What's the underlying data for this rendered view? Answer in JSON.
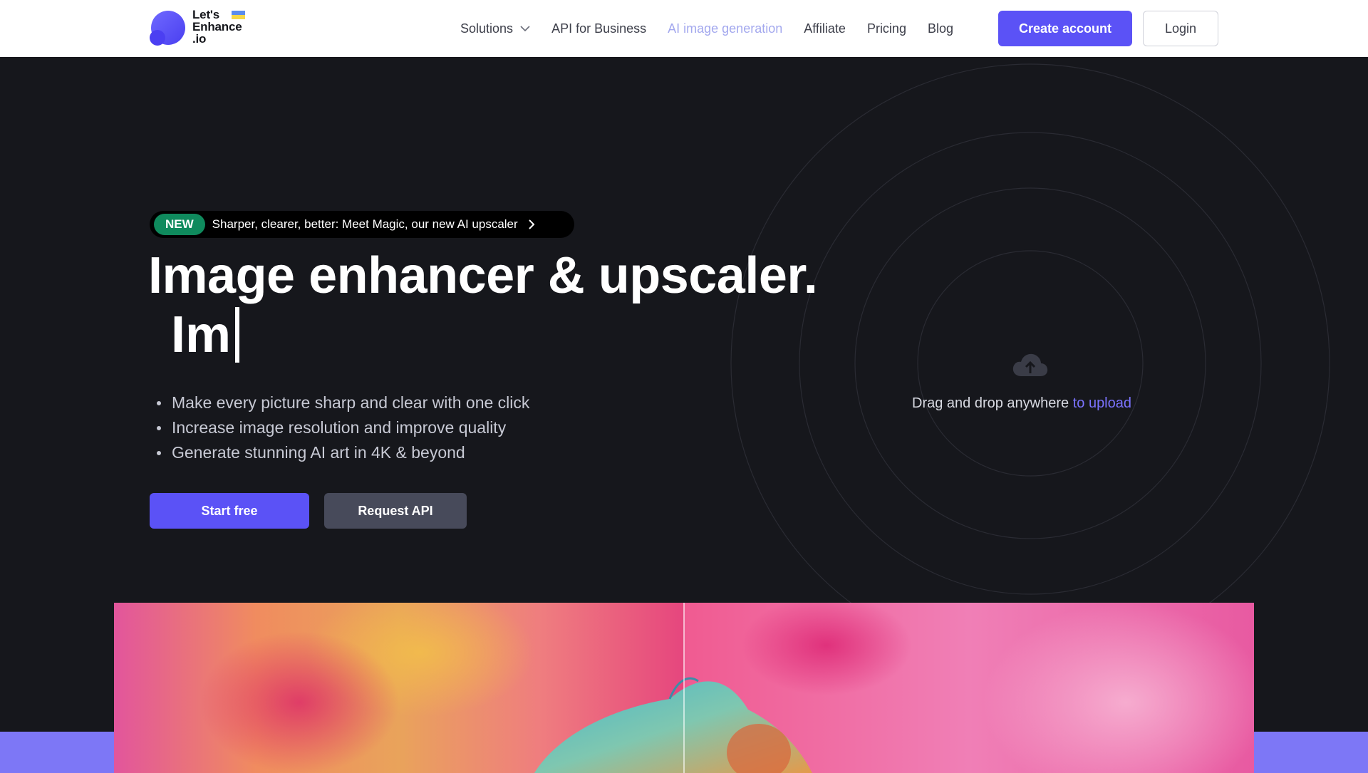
{
  "brand": {
    "logo_line1": "Let's",
    "logo_line2": "Enhance",
    "logo_line3": ".io",
    "accent": "#5b52f6"
  },
  "nav": {
    "items": [
      {
        "label": "Solutions",
        "has_dropdown": true
      },
      {
        "label": "API for Business"
      },
      {
        "label": "AI image generation"
      },
      {
        "label": "Affiliate"
      },
      {
        "label": "Pricing"
      },
      {
        "label": "Blog"
      }
    ],
    "create_account": "Create account",
    "login": "Login"
  },
  "hero": {
    "badge": "NEW",
    "announcement": "Sharper, clearer, better: Meet Magic, our new AI upscaler",
    "title": "Image enhancer & upscaler.",
    "typed_text": "Im",
    "bullets": [
      "Make every picture sharp and clear with one click",
      "Increase image resolution and improve quality",
      "Generate stunning AI art in 4K & beyond"
    ],
    "start_button": "Start free",
    "api_button": "Request API"
  },
  "upload": {
    "icon": "cloud-upload-icon",
    "text": "Drag and drop anywhere",
    "link": "to upload"
  }
}
